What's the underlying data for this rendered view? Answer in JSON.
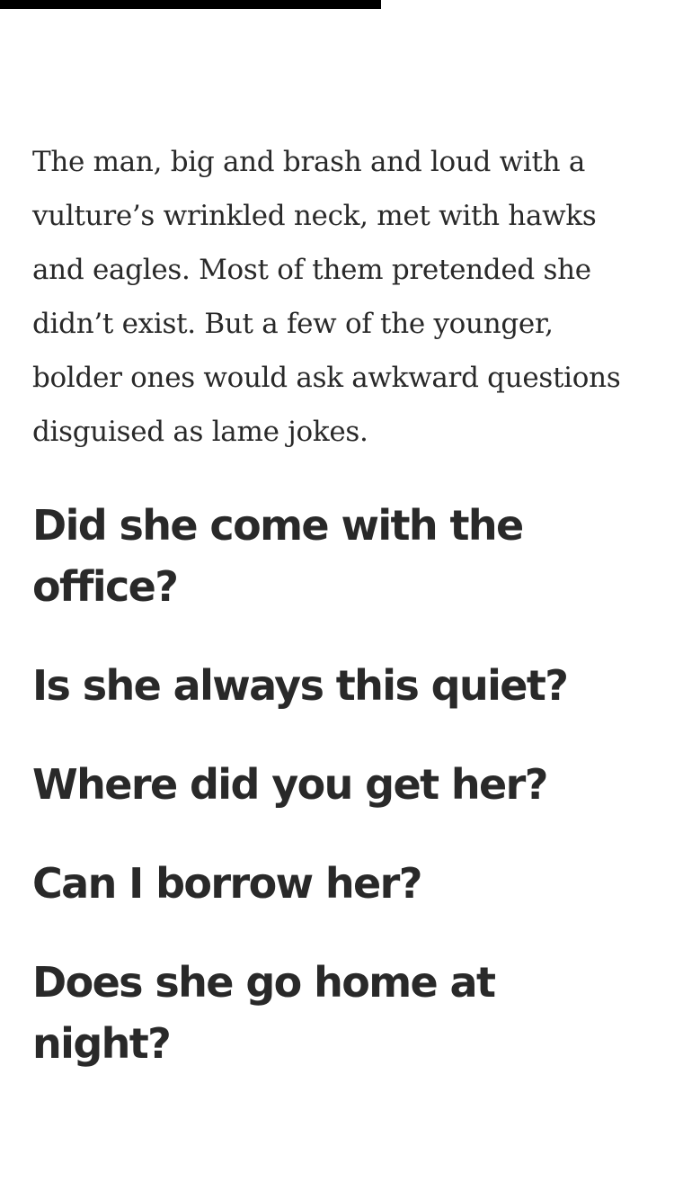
{
  "reading_progress": {
    "fraction": 0.565
  },
  "article": {
    "paragraph": "The man, big and brash and loud with a vulture’s wrinkled neck, met with hawks and eagles. Most of them pretended she didn’t exist. But a few of the younger, bolder ones would ask awkward questions disguised as lame jokes.",
    "questions": [
      "Did she come with the office?",
      "Is she always this quiet?",
      "Where did you get her?",
      "Can I borrow her?",
      "Does she go home at night?"
    ]
  },
  "colors": {
    "text": "#292929",
    "progress": "#000000",
    "background": "#ffffff"
  }
}
